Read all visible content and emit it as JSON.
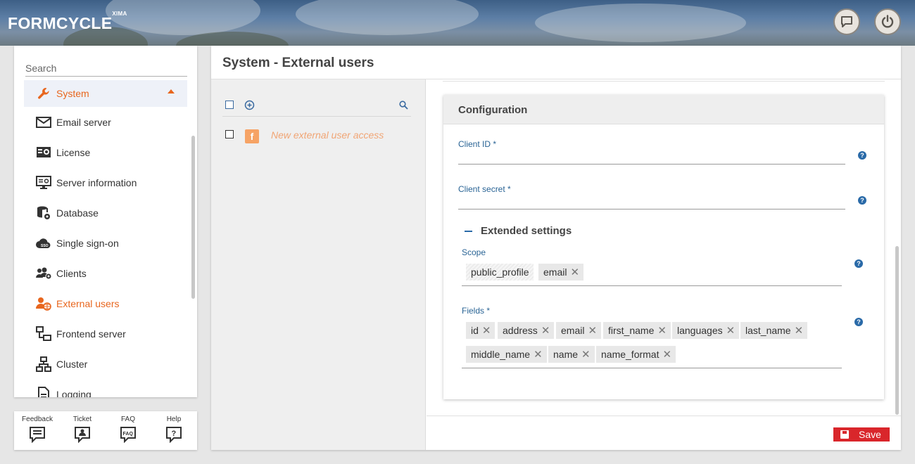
{
  "header": {
    "logo_text": "FORMCYCLE",
    "logo_sup": "XIMA",
    "chat_icon": "chat-icon",
    "power_icon": "power-icon"
  },
  "sidebar": {
    "search": {
      "placeholder": "Search",
      "value": ""
    },
    "section": {
      "label": "System",
      "icon": "wrench-icon"
    },
    "items": [
      {
        "label": "Email server",
        "icon": "envelope-icon"
      },
      {
        "label": "License",
        "icon": "license-icon"
      },
      {
        "label": "Server information",
        "icon": "monitor-icon"
      },
      {
        "label": "Database",
        "icon": "database-icon"
      },
      {
        "label": "Single sign-on",
        "icon": "cloud-sso-icon"
      },
      {
        "label": "Clients",
        "icon": "users-gear-icon"
      },
      {
        "label": "External users",
        "icon": "user-globe-icon",
        "active": true
      },
      {
        "label": "Frontend server",
        "icon": "frontend-server-icon"
      },
      {
        "label": "Cluster",
        "icon": "network-icon"
      },
      {
        "label": "Logging",
        "icon": "document-icon"
      }
    ],
    "helpbar": [
      {
        "label": "Feedback",
        "icon": "feedback-icon"
      },
      {
        "label": "Ticket",
        "icon": "ticket-icon"
      },
      {
        "label": "FAQ",
        "icon": "faq-icon"
      },
      {
        "label": "Help",
        "icon": "help-icon"
      }
    ]
  },
  "main": {
    "title": "System - External users",
    "list": {
      "items": [
        {
          "label": "New external user access",
          "icon": "facebook-icon"
        }
      ]
    },
    "config": {
      "title": "Configuration",
      "client_id": {
        "label": "Client ID *",
        "value": ""
      },
      "client_secret": {
        "label": "Client secret *",
        "value": ""
      },
      "extended_title": "Extended settings",
      "scope": {
        "label": "Scope",
        "chips": [
          "public_profile",
          "email"
        ]
      },
      "fields": {
        "label": "Fields *",
        "chips": [
          "id",
          "address",
          "email",
          "first_name",
          "languages",
          "last_name",
          "middle_name",
          "name",
          "name_format"
        ]
      }
    },
    "save_label": "Save"
  },
  "colors": {
    "accent": "#e8661e",
    "link": "#2a6495",
    "save": "#d9262b"
  }
}
